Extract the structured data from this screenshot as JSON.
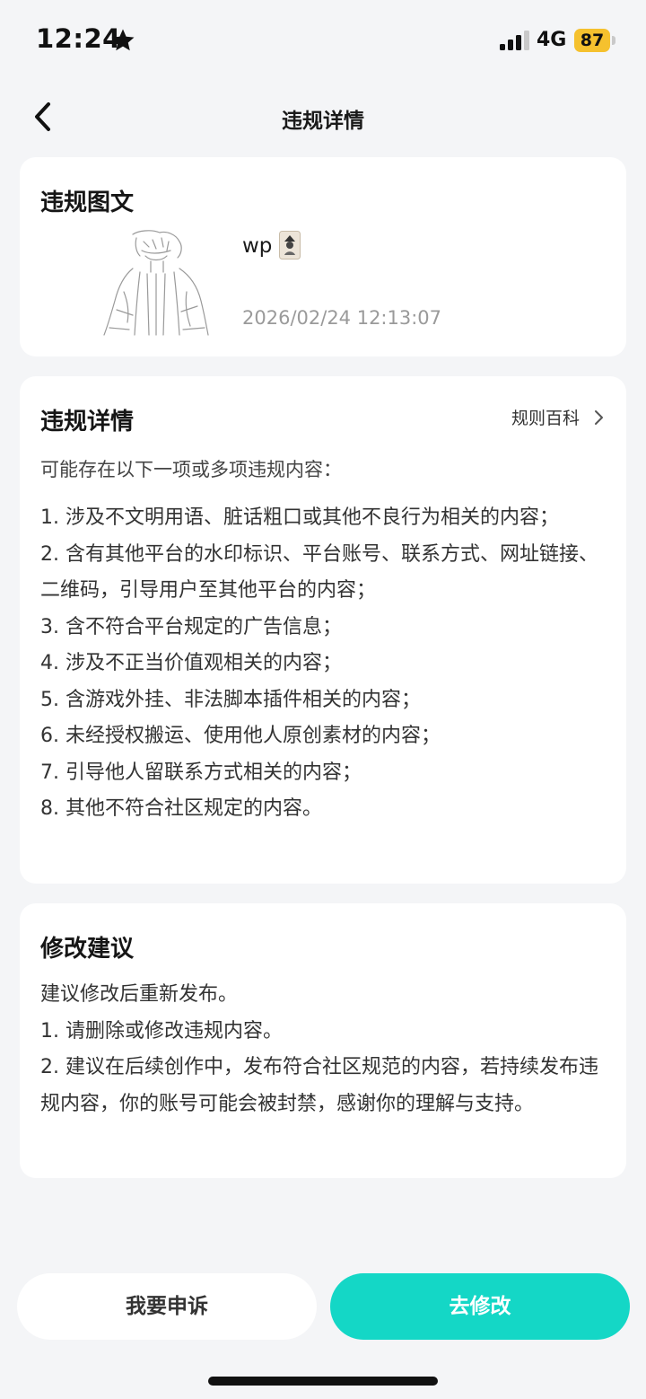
{
  "status_bar": {
    "time": "12:24",
    "network": "4G",
    "battery": "87"
  },
  "header": {
    "title": "违规详情"
  },
  "post_card": {
    "title": "违规图文",
    "author": "wp",
    "timestamp": "2026/02/24 12:13:07"
  },
  "detail_card": {
    "title": "违规详情",
    "rules_link": "规则百科",
    "intro": "可能存在以下一项或多项违规内容：",
    "items": [
      "1. 涉及不文明用语、脏话粗口或其他不良行为相关的内容；",
      "2. 含有其他平台的水印标识、平台账号、联系方式、网址链接、二维码，引导用户至其他平台的内容；",
      "3. 含不符合平台规定的广告信息；",
      "4. 涉及不正当价值观相关的内容；",
      "5. 含游戏外挂、非法脚本插件相关的内容；",
      "6. 未经授权搬运、使用他人原创素材的内容；",
      "7. 引导他人留联系方式相关的内容；",
      "8. 其他不符合社区规定的内容。"
    ]
  },
  "suggestion_card": {
    "title": "修改建议",
    "intro": "建议修改后重新发布。",
    "items": [
      "1. 请删除或修改违规内容。",
      "2. 建议在后续创作中，发布符合社区规范的内容，若持续发布违规内容，你的账号可能会被封禁，感谢你的理解与支持。"
    ]
  },
  "actions": {
    "appeal": "我要申诉",
    "modify": "去修改"
  },
  "colors": {
    "accent": "#14d7c6",
    "battery": "#f5c12e",
    "background": "#f4f5f7"
  },
  "icons": {
    "back": "chevron-left-icon",
    "star": "star-icon",
    "signal": "signal-icon",
    "rules_arrow": "chevron-right-icon"
  }
}
